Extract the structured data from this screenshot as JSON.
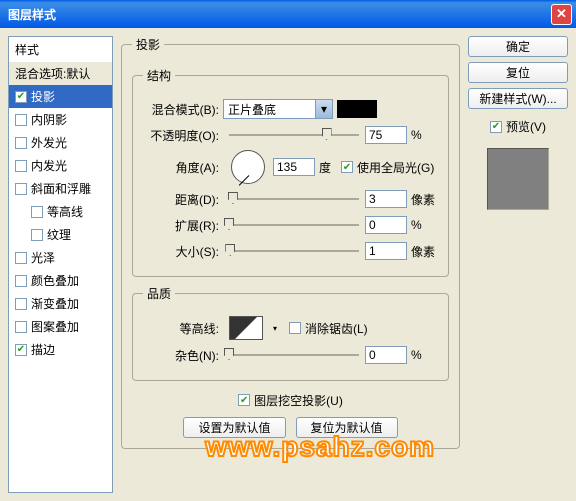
{
  "title": "图层样式",
  "left": {
    "header": "样式",
    "blend": "混合选项:默认",
    "items": [
      {
        "label": "投影",
        "checked": true,
        "active": true,
        "indent": false
      },
      {
        "label": "内阴影",
        "checked": false,
        "active": false,
        "indent": false
      },
      {
        "label": "外发光",
        "checked": false,
        "active": false,
        "indent": false
      },
      {
        "label": "内发光",
        "checked": false,
        "active": false,
        "indent": false
      },
      {
        "label": "斜面和浮雕",
        "checked": false,
        "active": false,
        "indent": false
      },
      {
        "label": "等高线",
        "checked": false,
        "active": false,
        "indent": true
      },
      {
        "label": "纹理",
        "checked": false,
        "active": false,
        "indent": true
      },
      {
        "label": "光泽",
        "checked": false,
        "active": false,
        "indent": false
      },
      {
        "label": "颜色叠加",
        "checked": false,
        "active": false,
        "indent": false
      },
      {
        "label": "渐变叠加",
        "checked": false,
        "active": false,
        "indent": false
      },
      {
        "label": "图案叠加",
        "checked": false,
        "active": false,
        "indent": false
      },
      {
        "label": "描边",
        "checked": true,
        "active": false,
        "indent": false
      }
    ]
  },
  "main": {
    "group_title": "投影",
    "structure_title": "结构",
    "blend_mode_label": "混合模式(B):",
    "blend_mode_value": "正片叠底",
    "color": "#000000",
    "opacity_label": "不透明度(O):",
    "opacity_value": "75",
    "opacity_unit": "%",
    "angle_label": "角度(A):",
    "angle_value": "135",
    "angle_unit": "度",
    "global_light_label": "使用全局光(G)",
    "global_light_checked": true,
    "distance_label": "距离(D):",
    "distance_value": "3",
    "distance_unit": "像素",
    "spread_label": "扩展(R):",
    "spread_value": "0",
    "spread_unit": "%",
    "size_label": "大小(S):",
    "size_value": "1",
    "size_unit": "像素",
    "quality_title": "品质",
    "contour_label": "等高线:",
    "antialiased_label": "消除锯齿(L)",
    "antialiased_checked": false,
    "noise_label": "杂色(N):",
    "noise_value": "0",
    "noise_unit": "%",
    "knockout_label": "图层挖空投影(U)",
    "knockout_checked": true,
    "set_default": "设置为默认值",
    "reset_default": "复位为默认值"
  },
  "right": {
    "ok": "确定",
    "cancel": "复位",
    "new_style": "新建样式(W)...",
    "preview_label": "预览(V)",
    "preview_checked": true
  },
  "watermark": "www.psahz.com"
}
